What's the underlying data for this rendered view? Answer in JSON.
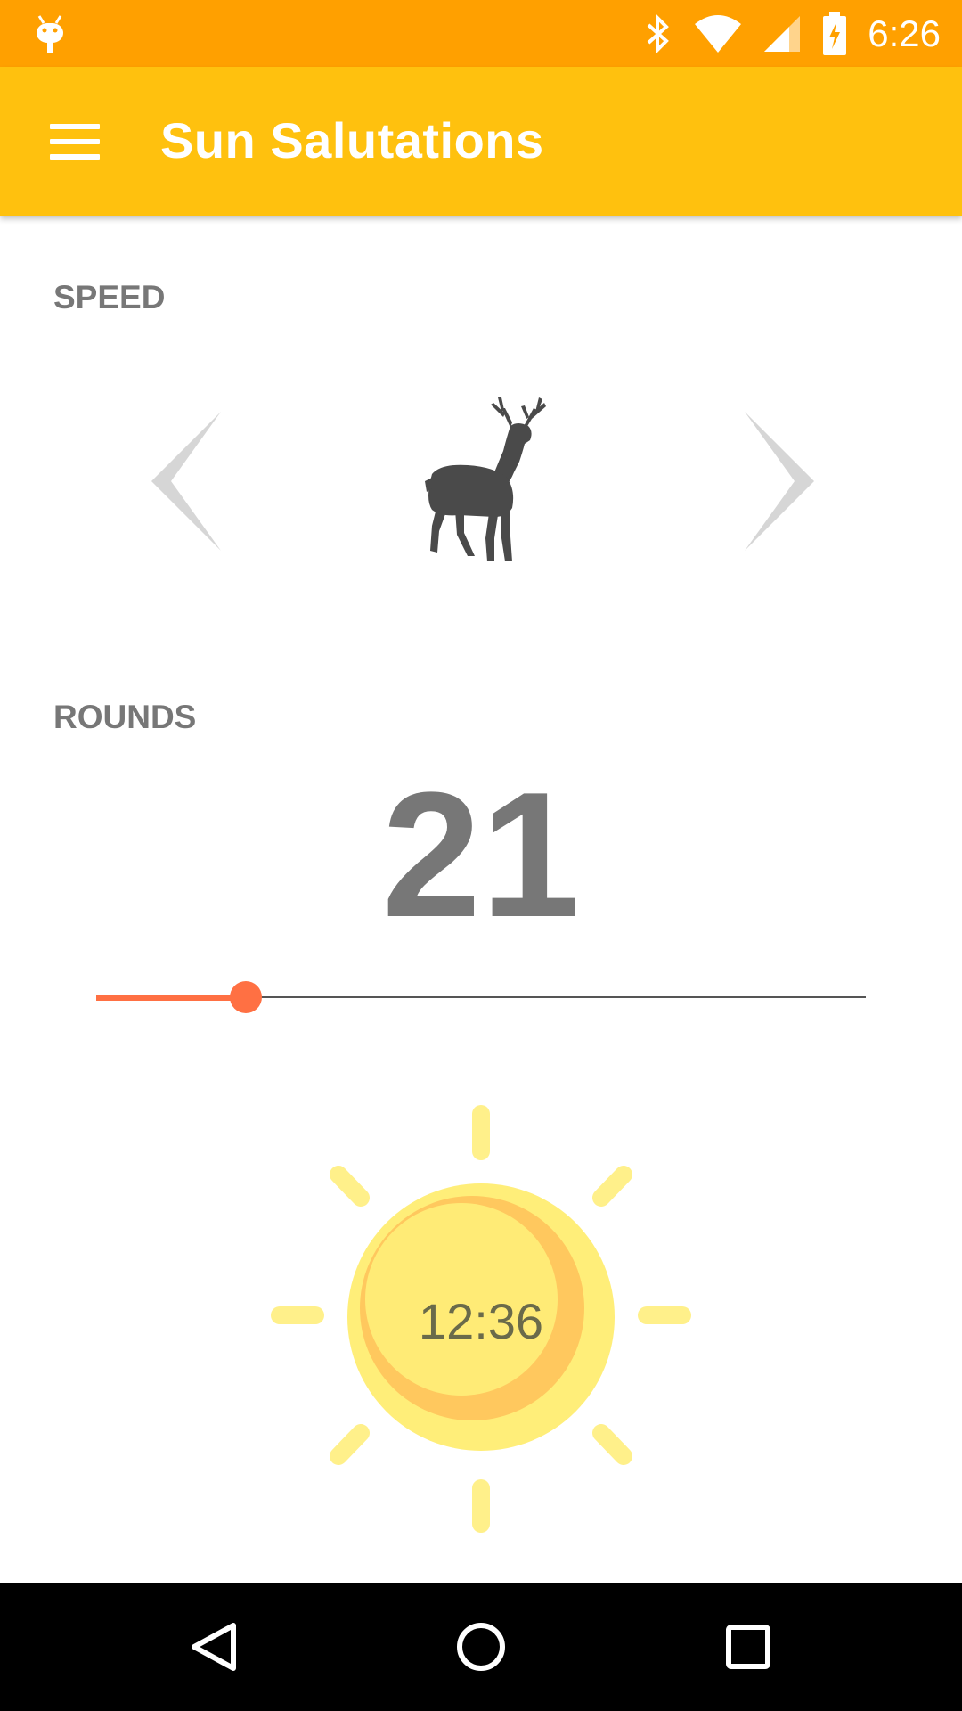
{
  "status_bar": {
    "time": "6:26",
    "icons": [
      "android-icon",
      "bluetooth-icon",
      "wifi-icon",
      "cell-signal-icon",
      "battery-charging-icon"
    ],
    "color": "#FFA000"
  },
  "app_bar": {
    "title": "Sun Salutations",
    "color": "#FFC10E",
    "menu_icon": "menu-icon"
  },
  "speed": {
    "label": "SPEED",
    "selected_icon": "deer-icon",
    "prev_icon": "chevron-left-icon",
    "next_icon": "chevron-right-icon"
  },
  "rounds": {
    "label": "ROUNDS",
    "value": "21",
    "slider_fraction": 0.195,
    "accent": "#FF7043"
  },
  "timer": {
    "value": "12:36",
    "icon": "sun-icon"
  },
  "nav_bar": {
    "buttons": [
      "back-icon",
      "home-icon",
      "recents-icon"
    ]
  }
}
